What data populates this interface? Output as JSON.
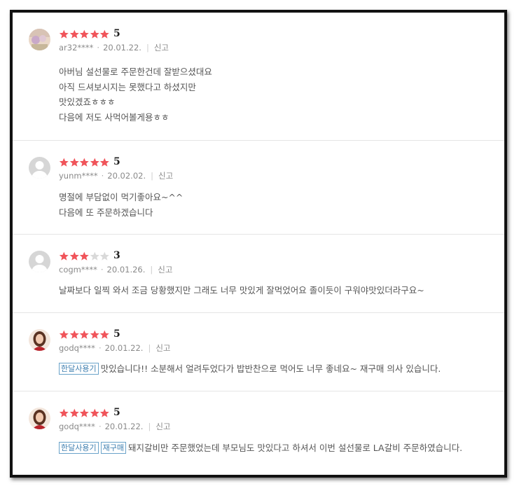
{
  "reviews": [
    {
      "avatar_icon": "profile-photo-icon",
      "rating": 5,
      "score_label": "5",
      "username": "ar32****",
      "date": "20.01.22.",
      "report_label": "신고",
      "badges": [],
      "lines": [
        "아버님 설선물로 주문한건데 잘받으셨대요",
        "아직 드셔보시지는 못했다고 하셨지만",
        "맛있겠죠ㅎㅎㅎ",
        "다음에 저도 사먹어볼게용ㅎㅎ"
      ]
    },
    {
      "avatar_icon": "default-user-icon",
      "rating": 5,
      "score_label": "5",
      "username": "yunm****",
      "date": "20.02.02.",
      "report_label": "신고",
      "badges": [],
      "lines": [
        "명절에 부담없이 먹기좋아요~^^",
        "다음에 또 주문하겠습니다"
      ]
    },
    {
      "avatar_icon": "default-user-icon",
      "rating": 3,
      "score_label": "3",
      "username": "cogm****",
      "date": "20.01.26.",
      "report_label": "신고",
      "badges": [],
      "lines": [
        "날짜보다 일찍 와서 조금 당황했지만 그래도 너무 맛있게 잘먹었어요 졸이듯이 구워야맛있더라구요~"
      ]
    },
    {
      "avatar_icon": "profile-photo-icon",
      "rating": 5,
      "score_label": "5",
      "username": "godq****",
      "date": "20.01.22.",
      "report_label": "신고",
      "badges": [
        "한달사용기"
      ],
      "lines": [
        "맛있습니다!! 소분해서 얼려두었다가 밥반찬으로 먹어도 너무 좋네요~ 재구매 의사 있습니다."
      ]
    },
    {
      "avatar_icon": "profile-photo-icon",
      "rating": 5,
      "score_label": "5",
      "username": "godq****",
      "date": "20.01.22.",
      "report_label": "신고",
      "badges": [
        "한달사용기",
        "재구매"
      ],
      "lines": [
        "돼지갈비만 주문했었는데 부모님도 맛있다고 하셔서 이번 설선물로 LA갈비 주문하였습니다."
      ]
    }
  ],
  "colors": {
    "star_filled": "#f0545a",
    "star_empty": "#d9d9d9",
    "badge_border": "#6aa3c9",
    "badge_text": "#3f7fb0",
    "meta_text": "#8a8a8a",
    "body_text": "#555555"
  }
}
